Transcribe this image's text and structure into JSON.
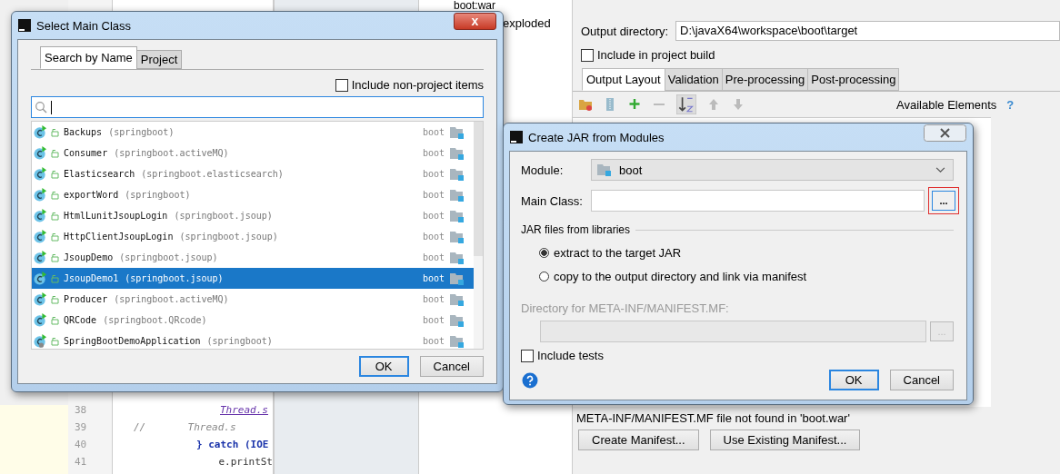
{
  "background": {
    "artifact_list": [
      {
        "name": "boot:war"
      },
      {
        "name": "exploded"
      }
    ],
    "code_lines": [
      {
        "number": "38",
        "code": "Thread.s",
        "kind": "static"
      },
      {
        "number": "39",
        "code": "//       Thread.s",
        "kind": "comment"
      },
      {
        "number": "40",
        "code": "} catch (IOE",
        "kind": "catch"
      },
      {
        "number": "41",
        "code": "e.printSt",
        "kind": "plain"
      }
    ]
  },
  "artifact_settings": {
    "output_directory": {
      "label": "Output directory:",
      "value": "D:\\javaX64\\workspace\\boot\\target"
    },
    "include_in_build": {
      "label": "Include in project build",
      "checked": false
    },
    "tabs": [
      {
        "label": "Output Layout",
        "selected": true
      },
      {
        "label": "Validation",
        "selected": false
      },
      {
        "label": "Pre-processing",
        "selected": false
      },
      {
        "label": "Post-processing",
        "selected": false
      }
    ],
    "available_elements": "Available Elements",
    "help": "?",
    "manifest_message": "META-INF/MANIFEST.MF file not found in 'boot.war'",
    "buttons": [
      "Create Manifest...",
      "Use Existing Manifest..."
    ]
  },
  "select_main_class": {
    "title": "Select Main Class",
    "close": "x",
    "tabs": [
      {
        "label": "Search by Name",
        "selected": true
      },
      {
        "label": "Project",
        "selected": false
      }
    ],
    "include_non_project": {
      "label": "Include non-project items",
      "checked": false
    },
    "classes": [
      {
        "name": "Backups",
        "package": "(springboot)",
        "module": "boot",
        "kind": "class",
        "selected": false
      },
      {
        "name": "Consumer",
        "package": "(springboot.activeMQ)",
        "module": "boot",
        "kind": "class",
        "selected": false
      },
      {
        "name": "Elasticsearch",
        "package": "(springboot.elasticsearch)",
        "module": "boot",
        "kind": "class",
        "selected": false
      },
      {
        "name": "exportWord",
        "package": "(springboot)",
        "module": "boot",
        "kind": "class",
        "selected": false
      },
      {
        "name": "HtmlLunitJsoupLogin",
        "package": "(springboot.jsoup)",
        "module": "boot",
        "kind": "class",
        "selected": false
      },
      {
        "name": "HttpClientJsoupLogin",
        "package": "(springboot.jsoup)",
        "module": "boot",
        "kind": "class",
        "selected": false
      },
      {
        "name": "JsoupDemo",
        "package": "(springboot.jsoup)",
        "module": "boot",
        "kind": "class",
        "selected": false
      },
      {
        "name": "JsoupDemo1",
        "package": "(springboot.jsoup)",
        "module": "boot",
        "kind": "class",
        "selected": true
      },
      {
        "name": "Producer",
        "package": "(springboot.activeMQ)",
        "module": "boot",
        "kind": "class",
        "selected": false
      },
      {
        "name": "QRCode",
        "package": "(springboot.QRcode)",
        "module": "boot",
        "kind": "class",
        "selected": false
      },
      {
        "name": "SpringBootDemoApplication",
        "package": "(springboot)",
        "module": "boot",
        "kind": "app",
        "selected": false
      }
    ],
    "buttons": [
      {
        "label": "OK",
        "default": true
      },
      {
        "label": "Cancel",
        "default": false
      }
    ]
  },
  "create_jar": {
    "title": "Create JAR from Modules",
    "module": {
      "label": "Module:",
      "value": "boot"
    },
    "main_class": {
      "label": "Main Class:",
      "browse": "...",
      "highlighted": true
    },
    "libraries_section": "JAR files from libraries",
    "options": [
      {
        "label": "extract to the target JAR",
        "selected": true
      },
      {
        "label": "copy to the output directory and link via manifest",
        "selected": false
      }
    ],
    "manifest_directory": {
      "label": "Directory for META-INF/MANIFEST.MF:",
      "browse": "...",
      "disabled": true
    },
    "include_tests": {
      "label": "Include tests",
      "checked": false
    },
    "buttons": [
      {
        "label": "OK",
        "default": true
      },
      {
        "label": "Cancel",
        "default": false
      }
    ]
  }
}
